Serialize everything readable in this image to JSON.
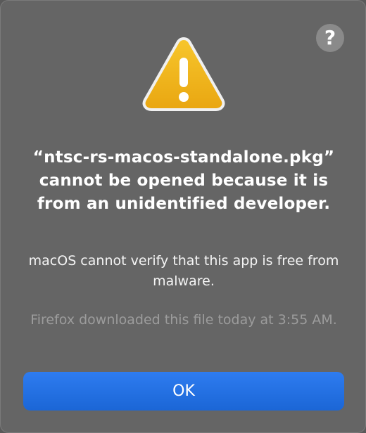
{
  "dialog": {
    "help_label": "?",
    "title": "“ntsc-rs-macos-standalone.pkg” cannot be opened because it is from an unidentified developer.",
    "message": "macOS cannot verify that this app is free from malware.",
    "download_info": "Firefox downloaded this file today at 3:55 AM.",
    "ok_label": "OK"
  },
  "icons": {
    "warning": "warning-triangle-icon",
    "help": "question-mark-icon"
  },
  "colors": {
    "dialog_background": "#656565",
    "accent": "#1f6fe0",
    "warning_fill": "#f2b11a",
    "secondary_text": "#9c9c9c"
  }
}
